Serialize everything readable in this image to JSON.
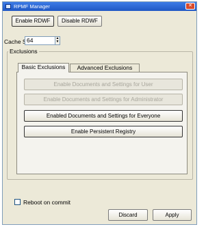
{
  "window": {
    "title": "RPMF Manager"
  },
  "toolbar": {
    "enable_label": "Enable RDWF",
    "disable_label": "Disable RDWF"
  },
  "cache": {
    "label": "Cache Size:",
    "value": "64"
  },
  "exclusions": {
    "legend": "Exclusions",
    "tabs": [
      {
        "label": "Basic Exclusions"
      },
      {
        "label": "Advanced Exclusions"
      }
    ],
    "buttons": [
      {
        "label": "Enable Documents and Settings for User",
        "enabled": false
      },
      {
        "label": "Enable Documents and Settings for Administrator",
        "enabled": false
      },
      {
        "label": "Enabled Documents and Settings for Everyone",
        "enabled": true
      },
      {
        "label": "Enable Persistent Registry",
        "enabled": true
      }
    ]
  },
  "footer": {
    "reboot_label": "Reboot on commit",
    "discard_label": "Discard",
    "apply_label": "Apply"
  }
}
